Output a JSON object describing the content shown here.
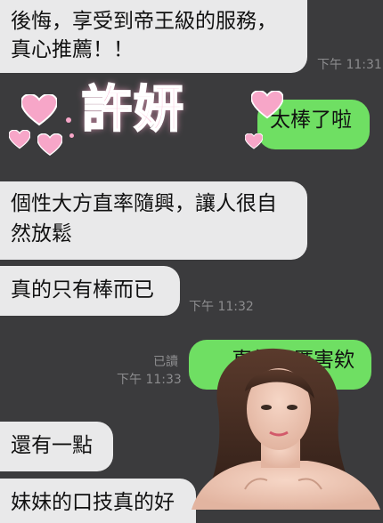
{
  "messages": [
    {
      "text": "後悔，享受到帝王級的服務，真心推薦！！",
      "time": "下午 11:31"
    },
    {
      "text": "太棒了啦"
    },
    {
      "text": "個性大方直率隨興，讓人很自然放鬆"
    },
    {
      "text": "真的只有棒而已",
      "time": "下午 11:32"
    },
    {
      "text": "真的很厲害欸",
      "read": "已讀",
      "time": "下午 11:33"
    },
    {
      "text": "還有一點"
    },
    {
      "text": "妹妹的口技真的好"
    }
  ],
  "overlay": {
    "title": "許妍"
  },
  "colors": {
    "incoming": "#e9e9ea",
    "outgoing": "#6fdf63",
    "background": "#3b3b3d",
    "title_pink": "#f7a6c8"
  }
}
